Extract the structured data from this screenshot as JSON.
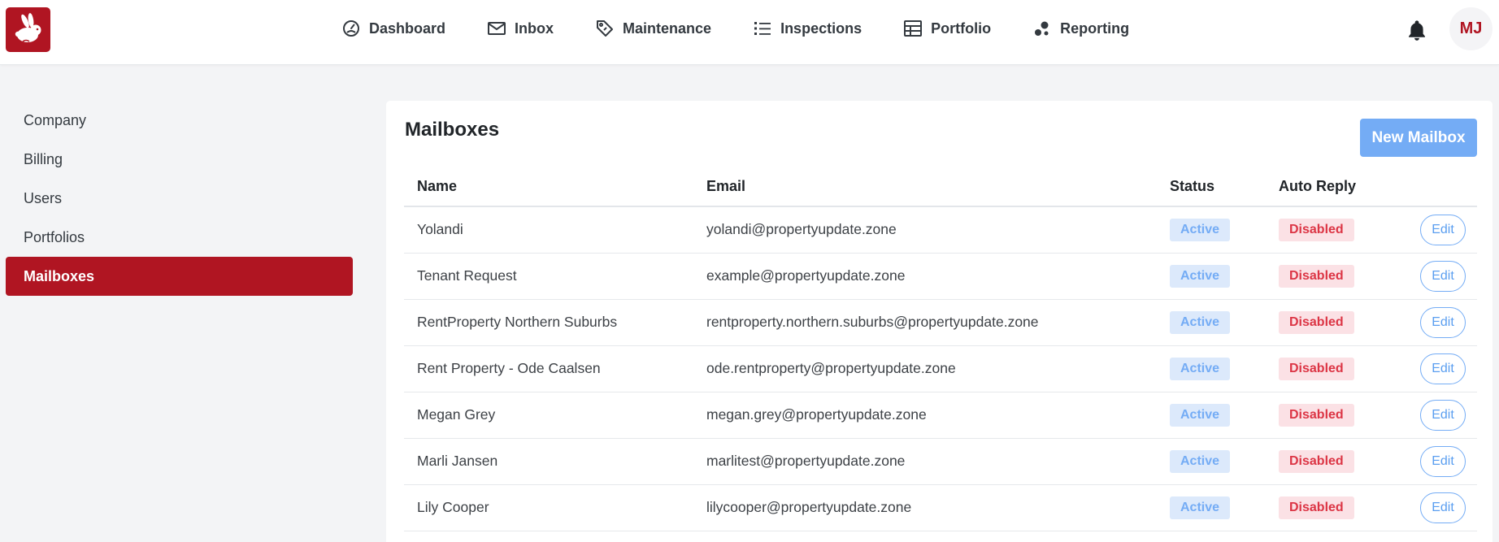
{
  "nav": {
    "items": [
      {
        "label": "Dashboard",
        "icon": "dashboard-gauge-icon"
      },
      {
        "label": "Inbox",
        "icon": "envelope-icon"
      },
      {
        "label": "Maintenance",
        "icon": "tag-icon"
      },
      {
        "label": "Inspections",
        "icon": "list-icon"
      },
      {
        "label": "Portfolio",
        "icon": "table-grid-icon"
      },
      {
        "label": "Reporting",
        "icon": "bubbles-icon"
      }
    ]
  },
  "user": {
    "initials": "MJ"
  },
  "sidebar": {
    "items": [
      {
        "label": "Company"
      },
      {
        "label": "Billing"
      },
      {
        "label": "Users"
      },
      {
        "label": "Portfolios"
      },
      {
        "label": "Mailboxes",
        "active": true
      }
    ]
  },
  "main": {
    "title": "Mailboxes",
    "new_button": "New Mailbox",
    "table": {
      "headers": [
        "Name",
        "Email",
        "Status",
        "Auto Reply"
      ],
      "rows": [
        {
          "name": "Yolandi",
          "email": "yolandi@propertyupdate.zone",
          "status": "Active",
          "auto_reply": "Disabled",
          "action": "Edit"
        },
        {
          "name": "Tenant Request",
          "email": "example@propertyupdate.zone",
          "status": "Active",
          "auto_reply": "Disabled",
          "action": "Edit"
        },
        {
          "name": "RentProperty Northern Suburbs",
          "email": "rentproperty.northern.suburbs@propertyupdate.zone",
          "status": "Active",
          "auto_reply": "Disabled",
          "action": "Edit"
        },
        {
          "name": "Rent Property - Ode Caalsen",
          "email": "ode.rentproperty@propertyupdate.zone",
          "status": "Active",
          "auto_reply": "Disabled",
          "action": "Edit"
        },
        {
          "name": "Megan Grey",
          "email": "megan.grey@propertyupdate.zone",
          "status": "Active",
          "auto_reply": "Disabled",
          "action": "Edit"
        },
        {
          "name": "Marli Jansen",
          "email": "marlitest@propertyupdate.zone",
          "status": "Active",
          "auto_reply": "Disabled",
          "action": "Edit"
        },
        {
          "name": "Lily Cooper",
          "email": "lilycooper@propertyupdate.zone",
          "status": "Active",
          "auto_reply": "Disabled",
          "action": "Edit"
        }
      ]
    }
  },
  "colors": {
    "brand": "#b01522",
    "primary": "#74acf5",
    "danger": "#dc3545",
    "background": "#f3f4f6"
  }
}
